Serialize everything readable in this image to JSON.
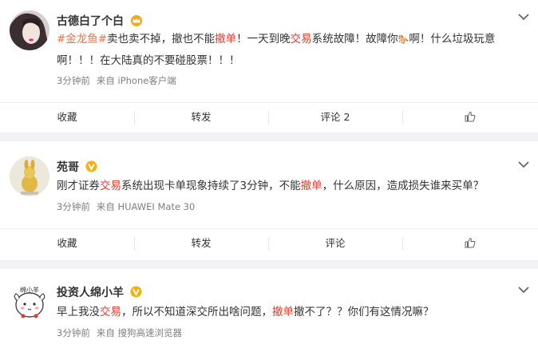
{
  "posts": [
    {
      "name": "古德白了个白",
      "content_lines": [
        [
          {
            "text": "#金龙鱼#",
            "style": "topic"
          },
          {
            "text": "卖也卖不掉，撤也不能",
            "style": "normal"
          },
          {
            "text": "撤单",
            "style": "hl"
          },
          {
            "text": "！一天到晚",
            "style": "normal"
          },
          {
            "text": "交易",
            "style": "hl"
          },
          {
            "text": "系统故障！故障你",
            "style": "normal"
          },
          {
            "text": "🐎",
            "style": "normal"
          },
          {
            "text": "啊！什么垃圾玩意",
            "style": "normal"
          }
        ],
        [
          {
            "text": "啊！！！在大陆真的不要碰股票！！！",
            "style": "normal"
          }
        ]
      ],
      "time": "3分钟前",
      "source": "来自 iPhone客户端",
      "actions": {
        "collect": "收藏",
        "forward": "转发",
        "comment": "评论 2"
      }
    },
    {
      "name": "苑哥",
      "content_lines": [
        [
          {
            "text": "刚才证券",
            "style": "normal"
          },
          {
            "text": "交易",
            "style": "hl"
          },
          {
            "text": "系统出现卡单现象持续了3分钟，不能",
            "style": "normal"
          },
          {
            "text": "撤单",
            "style": "hl"
          },
          {
            "text": "，什么原因，造成损失谁来买单？",
            "style": "normal"
          }
        ]
      ],
      "time": "3分钟前",
      "source": "来自 HUAWEI Mate 30",
      "actions": {
        "collect": "收藏",
        "forward": "转发",
        "comment": "评论"
      }
    },
    {
      "name": "投资人绵小羊",
      "content_lines": [
        [
          {
            "text": "早上我没",
            "style": "normal"
          },
          {
            "text": "交易",
            "style": "hl"
          },
          {
            "text": "，所以不知道深交所出啥问题，",
            "style": "normal"
          },
          {
            "text": "撤单",
            "style": "hl"
          },
          {
            "text": "撤不了？？你们有这情况嘛？",
            "style": "normal"
          }
        ]
      ],
      "time": "3分钟前",
      "source": "来自 搜狗高速浏览器"
    }
  ],
  "avatar3_text": "绵小羊",
  "colors": {
    "highlight": "#e8392e",
    "topic": "#eb7350",
    "vip": "#f9b00a"
  }
}
